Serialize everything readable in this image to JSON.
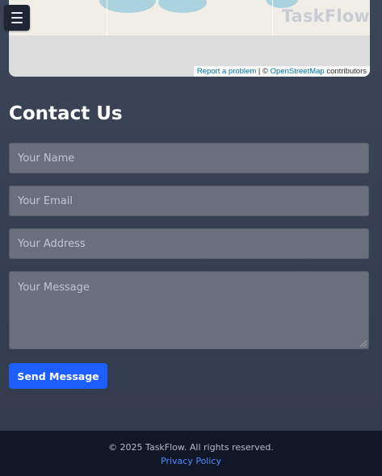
{
  "map": {
    "watermark": "TaskFlow",
    "attribution": {
      "report_link": "Report a problem",
      "separator": " | © ",
      "osm_link": "OpenStreetMap",
      "suffix": " contributors"
    }
  },
  "nav": {
    "menu_icon": "hamburger-menu-icon"
  },
  "contact": {
    "title": "Contact Us",
    "name_placeholder": "Your Name",
    "email_placeholder": "Your Email",
    "address_placeholder": "Your Address",
    "message_placeholder": "Your Message",
    "submit_label": "Send Message"
  },
  "footer": {
    "copyright": "© 2025 TaskFlow. All rights reserved.",
    "privacy_link": "Privacy Policy"
  },
  "colors": {
    "accent": "#1d5eff",
    "footer_bg": "#101828",
    "link": "#4f8cff"
  }
}
